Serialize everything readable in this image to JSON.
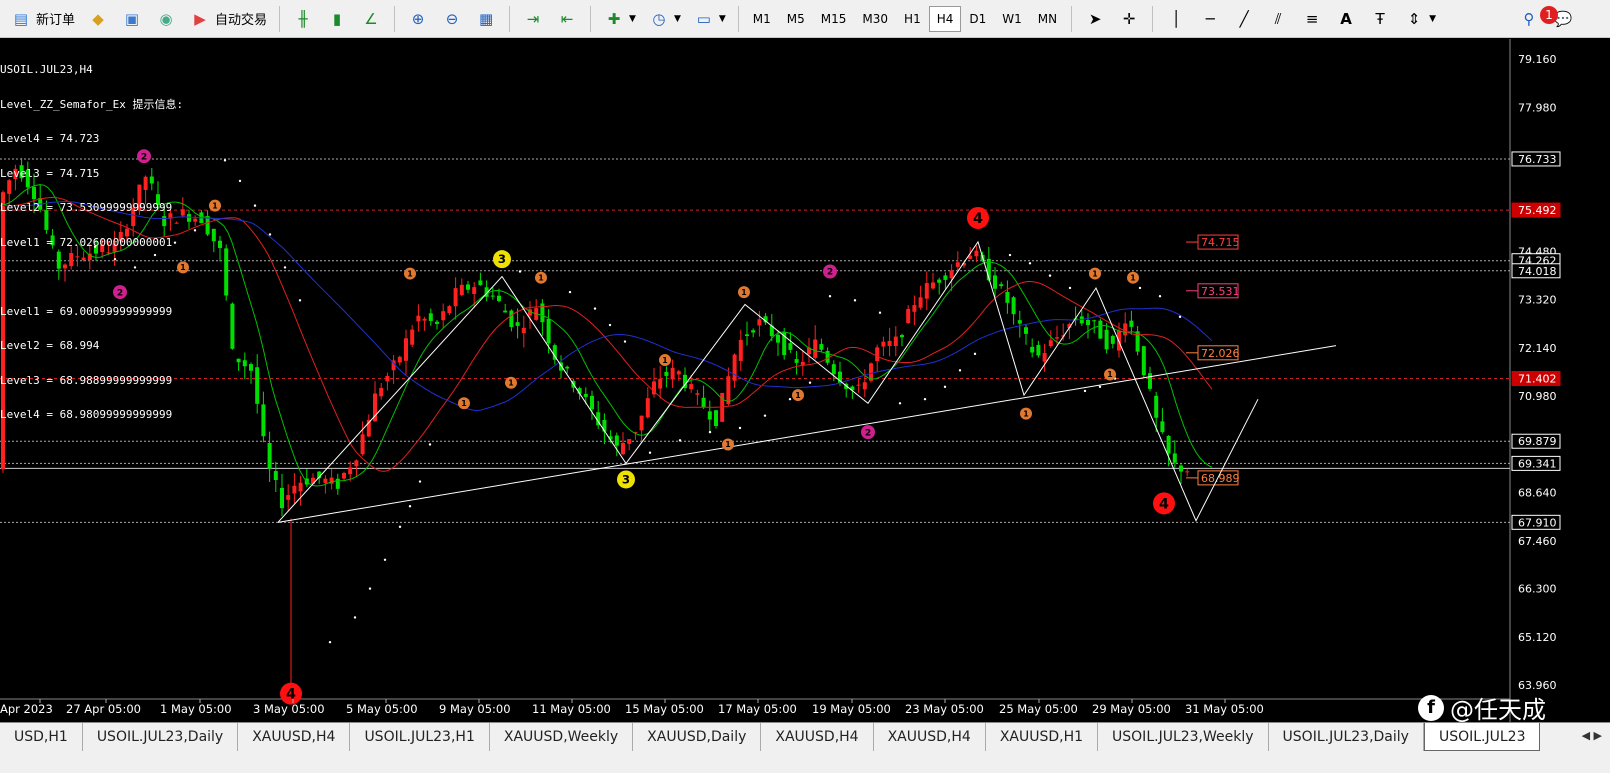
{
  "toolbar": {
    "new_order": "新订单",
    "auto_trading": "自动交易",
    "timeframes": [
      "M1",
      "M5",
      "M15",
      "M30",
      "H1",
      "H4",
      "D1",
      "W1",
      "MN"
    ],
    "active_timeframe": "H4",
    "notification_count": "1"
  },
  "chart": {
    "symbol_title": "USOIL.JUL23,H4",
    "indicator_title": "Level_ZZ_Semafor_Ex 提示信息:",
    "levels_upper": [
      "Level4 = 74.723",
      "Level3 = 74.715",
      "Level2 = 73.53099999999999",
      "Level1 = 72.02600000000001"
    ],
    "levels_lower": [
      "Level1 = 69.00099999999999",
      "Level2 = 68.994",
      "Level3 = 68.98899999999999",
      "Level4 = 68.98099999999999"
    ],
    "price_axis": [
      "79.160",
      "77.980",
      "76.733",
      "75.492",
      "74.480",
      "74.262",
      "74.018",
      "73.320",
      "72.140",
      "71.402",
      "70.980",
      "69.879",
      "69.341",
      "68.640",
      "67.910",
      "67.460",
      "66.300",
      "65.120",
      "63.960"
    ],
    "highlighted_prices": [
      {
        "label": "76.733",
        "bg": "#000000",
        "fg": "#ffffff"
      },
      {
        "label": "75.492",
        "bg": "#cc0000",
        "fg": "#ffffff"
      },
      {
        "label": "74.262",
        "bg": "#000000",
        "fg": "#ffffff"
      },
      {
        "label": "74.018",
        "bg": "#000000",
        "fg": "#ffffff"
      },
      {
        "label": "71.402",
        "bg": "#cc0000",
        "fg": "#ffffff"
      },
      {
        "label": "69.879",
        "bg": "#000000",
        "fg": "#ffffff"
      },
      {
        "label": "69.341",
        "bg": "#000000",
        "fg": "#ffffff"
      },
      {
        "label": "67.910",
        "bg": "#000000",
        "fg": "#ffffff"
      }
    ],
    "level_labels": [
      {
        "text": "74.715",
        "color": "#ff4040"
      },
      {
        "text": "73.531",
        "color": "#ff4080"
      },
      {
        "text": "72.026",
        "color": "#ff8040"
      },
      {
        "text": "68.989",
        "color": "#ff8040"
      }
    ],
    "date_axis": [
      "Apr 2023",
      "27 Apr 05:00",
      "1 May 05:00",
      "3 May 05:00",
      "5 May 05:00",
      "9 May 05:00",
      "11 May 05:00",
      "15 May 05:00",
      "17 May 05:00",
      "19 May 05:00",
      "23 May 05:00",
      "25 May 05:00",
      "29 May 05:00",
      "31 May 05:00"
    ],
    "semafor_marks": [
      "1",
      "2",
      "3",
      "4"
    ],
    "colors": {
      "bull": "#ff2020",
      "bear": "#00e000",
      "ma_fast": "#00c000",
      "ma_mid": "#e02020",
      "ma_slow": "#2030d0",
      "zigzag": "#ffffff",
      "grid_red": "#cc2020"
    }
  },
  "tabs": [
    "USD,H1",
    "USOIL.JUL23,Daily",
    "XAUUSD,H4",
    "USOIL.JUL23,H1",
    "XAUUSD,Weekly",
    "XAUUSD,Daily",
    "XAUUSD,H4",
    "XAUUSD,H4",
    "XAUUSD,H1",
    "USOIL.JUL23,Weekly",
    "USOIL.JUL23,Daily",
    "USOIL.JUL23"
  ],
  "active_tab_index": 11,
  "watermark": {
    "logo": "f",
    "text": "@任天成"
  }
}
